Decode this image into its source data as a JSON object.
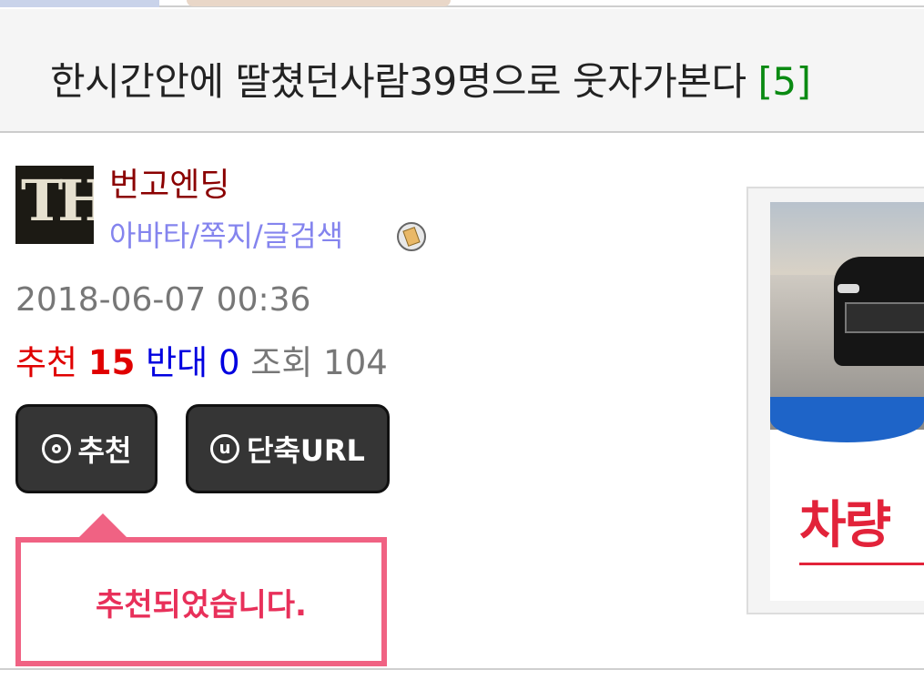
{
  "post": {
    "title": "한시간안에 딸쳤던사람39명으로 웃자가본다",
    "comment_count": "[5]",
    "author_name": "번고엔딩",
    "author_links": "아바타/쪽지/글검색",
    "avatar_text": "TH",
    "date": "2018-06-07 00:36"
  },
  "stats": {
    "recommend_label": "추천",
    "recommend_value": "15",
    "oppose_label": "반대",
    "oppose_value": "0",
    "views_label": "조회",
    "views_value": "104"
  },
  "buttons": {
    "recommend_label": "추천",
    "shorturl_label": "단축URL",
    "shorturl_icon_glyph": "u"
  },
  "toast": {
    "message": "추천되었습니다."
  },
  "ad": {
    "text": "차량"
  },
  "colors": {
    "comment_count": "#0a8a12",
    "author_name": "#8b0000",
    "author_links": "#8484ee",
    "recommend": "#e00000",
    "oppose": "#0000e0",
    "toast_border": "#f06283",
    "toast_text": "#e8305a",
    "button_bg": "#353535"
  },
  "icons": {
    "badge": "badge-icon",
    "recommend": "target-circle-icon",
    "shorturl": "u-circle-icon"
  }
}
